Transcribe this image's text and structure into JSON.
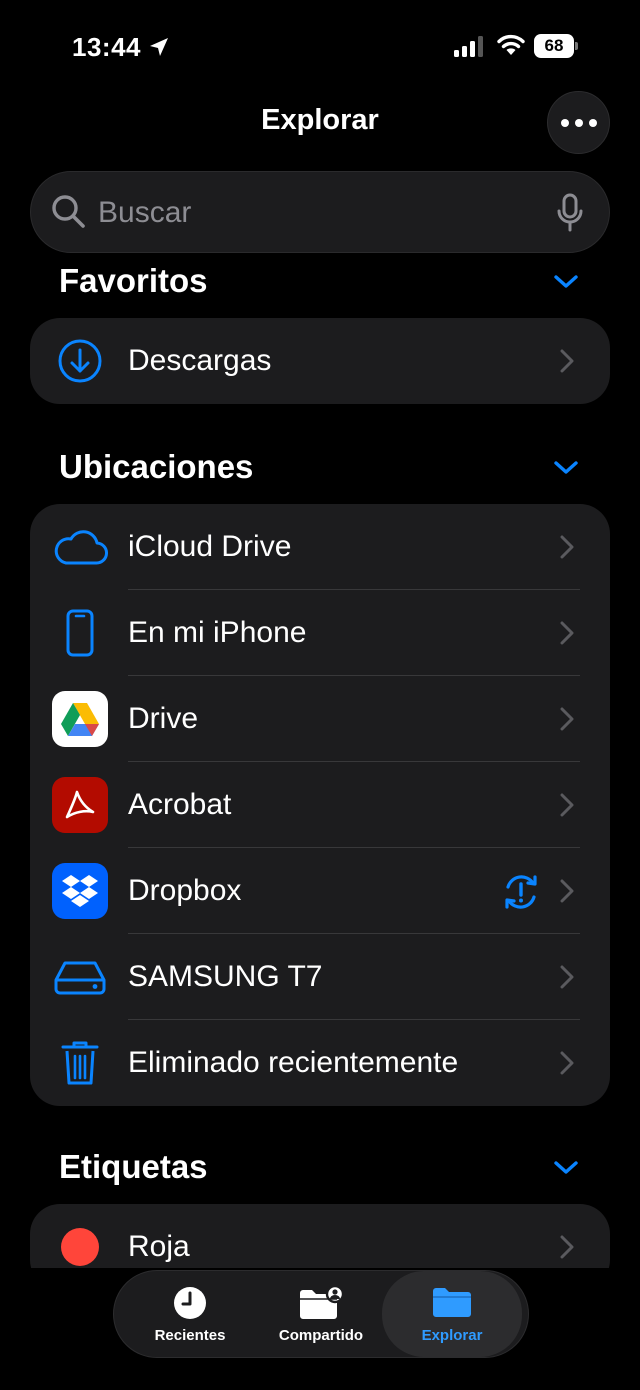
{
  "status_bar": {
    "time": "13:44",
    "battery": "68"
  },
  "header": {
    "title": "Explorar"
  },
  "search": {
    "placeholder": "Buscar"
  },
  "favorites": {
    "title": "Favoritos",
    "items": [
      {
        "label": "Descargas",
        "icon": "download-icon"
      }
    ]
  },
  "locations": {
    "title": "Ubicaciones",
    "items": [
      {
        "label": "iCloud Drive",
        "icon": "icloud-icon"
      },
      {
        "label": "En mi iPhone",
        "icon": "iphone-icon"
      },
      {
        "label": "Drive",
        "icon": "google-drive-icon"
      },
      {
        "label": "Acrobat",
        "icon": "acrobat-icon"
      },
      {
        "label": "Dropbox",
        "icon": "dropbox-icon"
      },
      {
        "label": "SAMSUNG T7",
        "icon": "external-drive-icon"
      },
      {
        "label": "Eliminado recientemente",
        "icon": "trash-icon"
      }
    ]
  },
  "tags": {
    "title": "Etiquetas",
    "items": [
      {
        "label": "Roja",
        "color": "#ff453a"
      }
    ]
  },
  "tab_bar": {
    "tabs": [
      {
        "label": "Recientes",
        "icon": "clock-icon"
      },
      {
        "label": "Compartido",
        "icon": "shared-folder-icon"
      },
      {
        "label": "Explorar",
        "icon": "folder-icon",
        "active": true
      }
    ]
  },
  "colors": {
    "accent": "#0a84ff",
    "background": "#000000",
    "card": "#1c1c1e"
  }
}
